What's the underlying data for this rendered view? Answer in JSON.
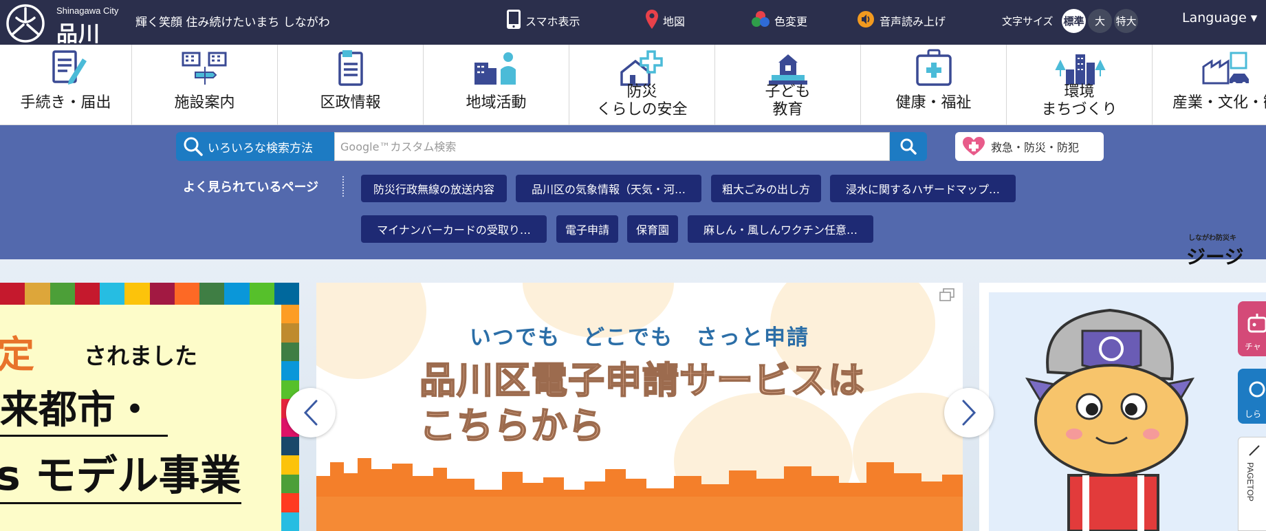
{
  "header": {
    "logo_en": "Shinagawa City",
    "logo_jp": "品川区",
    "slogan": "輝く笑顔 住み続けたいまち しながわ",
    "tools": [
      {
        "label": "スマホ表示",
        "icon": "smartphone-icon"
      },
      {
        "label": "地図",
        "icon": "map-pin-icon"
      },
      {
        "label": "色変更",
        "icon": "color-circles-icon"
      },
      {
        "label": "音声読み上げ",
        "icon": "speaker-icon"
      }
    ],
    "font_size": {
      "label": "文字サイズ",
      "options": [
        "標準",
        "大",
        "特大"
      ],
      "selected": "標準"
    },
    "language": "Language ▾"
  },
  "categories": [
    {
      "label": "手続き・届出",
      "icon": "form-pen-icon"
    },
    {
      "label": "施設案内",
      "icon": "facility-signpost-icon"
    },
    {
      "label": "区政情報",
      "icon": "document-icon"
    },
    {
      "label": "地域活動",
      "icon": "community-person-icon"
    },
    {
      "label": "防災\nくらしの安全",
      "icon": "house-cross-icon"
    },
    {
      "label": "子ども\n教育",
      "icon": "school-building-icon"
    },
    {
      "label": "健康・福祉",
      "icon": "medical-kit-icon"
    },
    {
      "label": "環境\nまちづくり",
      "icon": "city-trees-icon"
    },
    {
      "label": "産業・文化・観",
      "icon": "factory-car-icon"
    }
  ],
  "search": {
    "method_label": "いろいろな検索方法",
    "placeholder": "Google™カスタム検索",
    "value": "",
    "emergency_label": "救急・防災・防犯"
  },
  "popular": {
    "label": "よく見られているページ",
    "links": [
      "防災行政無線の放送内容",
      "品川区の気象情報（天気・河…",
      "粗大ごみの出し方",
      "浸水に関するハザードマップ…",
      "マイナンバーカードの受取り…",
      "電子申請",
      "保育園",
      "麻しん・風しんワクチン任意…"
    ]
  },
  "slides": {
    "left": {
      "t1": "定",
      "t2": "されました",
      "t3": "来都市・",
      "t4": "s モデル事業"
    },
    "main": {
      "subtitle": "いつでも　どこでも　さっと申請",
      "title_line1": "品川区電子申請サービスは",
      "title_line2": "こちらから"
    },
    "right": {
      "caption": "しながわ防災キ",
      "name": "ジージ"
    }
  },
  "side_tabs": [
    {
      "label": "チャ",
      "icon": "robot-icon",
      "color": "#d44a78"
    },
    {
      "label": "しら",
      "icon": "search-icon",
      "color": "#1d7bc3"
    }
  ],
  "pagetop": "PAGETOP",
  "colors": {
    "topbar": "#2b2f4c",
    "band": "#5369ad",
    "pill": "#1e2a74",
    "accent_blue": "#1d7bc3",
    "icon_blue": "#3a4a94",
    "icon_cyan": "#4bbbd8"
  }
}
